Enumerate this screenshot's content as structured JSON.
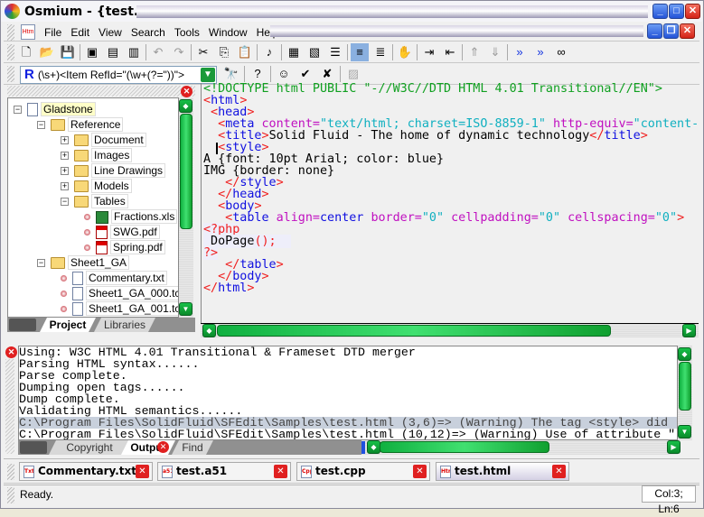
{
  "window": {
    "title": "Osmium - {test.html}",
    "minimize": "_",
    "maximize": "□",
    "close": "✕",
    "app_icon": "osmium-logo-icon"
  },
  "menu": {
    "items": [
      "File",
      "Edit",
      "View",
      "Search",
      "Tools",
      "Window",
      "Help"
    ],
    "doc_icon": "htm-file-icon"
  },
  "toolbar1": {
    "icons": [
      "new-file-icon",
      "open-folder-icon",
      "save-icon",
      "new-project-icon",
      "open-project-icon",
      "save-project-icon",
      "undo-icon",
      "redo-icon",
      "cut-icon",
      "copy-icon",
      "paste-icon",
      "spell-check-icon",
      "word-wrap-icon",
      "char-icon",
      "document-icon",
      "align-left-icon",
      "align-justify-icon",
      "clipboard-select-icon",
      "indent-icon",
      "outdent-icon",
      "move-up-icon",
      "move-down-icon",
      "add-bookmark-icon",
      "remove-bookmark-icon",
      "bookmarks-icon"
    ]
  },
  "toolbar2": {
    "search_value": "(\\s+)<Item RefId=\"(\\w+(?=\"))\">",
    "regex_label": "R",
    "icons": [
      "find-icon",
      "help-doc-icon",
      "smiley-doc-icon",
      "check-doc-icon",
      "cancel-doc-icon",
      "disabled-doc-icon"
    ]
  },
  "project": {
    "tree": [
      {
        "label": "Gladstone",
        "level": 0,
        "type": "project",
        "exp": "-",
        "selected": true
      },
      {
        "label": "Reference",
        "level": 1,
        "type": "folder",
        "exp": "-"
      },
      {
        "label": "Document",
        "level": 2,
        "type": "folder",
        "exp": "+"
      },
      {
        "label": "Images",
        "level": 2,
        "type": "folder",
        "exp": "+"
      },
      {
        "label": "Line Drawings",
        "level": 2,
        "type": "folder",
        "exp": "+"
      },
      {
        "label": "Models",
        "level": 2,
        "type": "folder",
        "exp": "+"
      },
      {
        "label": "Tables",
        "level": 2,
        "type": "folder",
        "exp": "-"
      },
      {
        "label": "Fractions.xls",
        "level": 3,
        "type": "xls"
      },
      {
        "label": "SWG.pdf",
        "level": 3,
        "type": "pdf"
      },
      {
        "label": "Spring.pdf",
        "level": 3,
        "type": "pdf"
      },
      {
        "label": "Sheet1_GA",
        "level": 1,
        "type": "folder",
        "exp": "-"
      },
      {
        "label": "Commentary.txt",
        "level": 2,
        "type": "txt"
      },
      {
        "label": "Sheet1_GA_000.tcw",
        "level": 2,
        "type": "tcw"
      },
      {
        "label": "Sheet1_GA_001.tcw",
        "level": 2,
        "type": "tcw"
      }
    ],
    "tabs": [
      "Project",
      "Libraries"
    ],
    "active_tab": "Project"
  },
  "editor": {
    "lines": [
      [
        [
          "<!DOCTYPE html PUBLIC \"-//W3C//DTD HTML 4.01 Transitional//EN\">",
          "g"
        ]
      ],
      [
        [
          "<",
          "r"
        ],
        [
          "html",
          "b"
        ],
        [
          ">",
          "r"
        ]
      ],
      [
        [
          " <",
          "r"
        ],
        [
          "head",
          "b"
        ],
        [
          ">",
          "r"
        ]
      ],
      [
        [
          "  <",
          "r"
        ],
        [
          "meta ",
          "b"
        ],
        [
          "content=",
          "m"
        ],
        [
          "\"text/html; charset=ISO-8859-1\" ",
          "c"
        ],
        [
          "http-equiv=",
          "m"
        ],
        [
          "\"content-type\">",
          "c"
        ]
      ],
      [
        [
          "  <",
          "r"
        ],
        [
          "title",
          "b"
        ],
        [
          ">",
          "r"
        ],
        [
          "Solid Fluid - The home of dynamic technology",
          "k"
        ],
        [
          "</",
          "r"
        ],
        [
          "title",
          "b"
        ],
        [
          ">",
          "r"
        ]
      ],
      [
        [
          "  <",
          "r"
        ],
        [
          "style",
          "b"
        ],
        [
          ">",
          "r"
        ]
      ],
      [
        [
          "A {font: 10pt Arial; color: blue}",
          "k"
        ]
      ],
      [
        [
          "IMG {border: none}",
          "k"
        ]
      ],
      [
        [
          "   </",
          "r"
        ],
        [
          "style",
          "b"
        ],
        [
          ">",
          "r"
        ]
      ],
      [
        [
          "  </",
          "r"
        ],
        [
          "head",
          "b"
        ],
        [
          ">",
          "r"
        ]
      ],
      [
        [
          "  <",
          "r"
        ],
        [
          "body",
          "b"
        ],
        [
          ">",
          "r"
        ]
      ],
      [
        [
          "   <",
          "r"
        ],
        [
          "table ",
          "b"
        ],
        [
          "align=",
          "m"
        ],
        [
          "center ",
          "b"
        ],
        [
          "border=",
          "m"
        ],
        [
          "\"0\" ",
          "c"
        ],
        [
          "cellpadding=",
          "m"
        ],
        [
          "\"0\" ",
          "c"
        ],
        [
          "cellspacing=",
          "m"
        ],
        [
          "\"0\"",
          "c"
        ],
        [
          ">",
          "r"
        ]
      ],
      [
        [
          "<?php",
          "r",
          "hl"
        ]
      ],
      [
        [
          " DoPage",
          "k",
          "hl"
        ],
        [
          "();",
          "r",
          "hl"
        ],
        [
          "  ",
          "k",
          "hl"
        ]
      ],
      [
        [
          "?>",
          "r",
          "hl"
        ]
      ],
      [
        [
          "   </",
          "r"
        ],
        [
          "table",
          "b"
        ],
        [
          ">",
          "r"
        ]
      ],
      [
        [
          "  </",
          "r"
        ],
        [
          "body",
          "b"
        ],
        [
          ">",
          "r"
        ]
      ],
      [
        [
          "</",
          "r"
        ],
        [
          "html",
          "b"
        ],
        [
          ">",
          "r"
        ]
      ]
    ]
  },
  "output": {
    "lines": [
      "Using: W3C HTML 4.01 Transitional & Frameset DTD merger",
      "Parsing HTML syntax......",
      "Parse complete.",
      "Dumping open tags......",
      "Dump complete.",
      "Validating HTML semantics......",
      "C:\\Program Files\\SolidFluid\\SFEdit\\Samples\\test.html (3,6)=> (Warning) The tag <style> did",
      "C:\\Program Files\\SolidFluid\\SFEdit\\Samples\\test.html (10,12)=> (Warning) Use of attribute \""
    ],
    "selected_line": 6,
    "tabs": [
      "Copyright",
      "Output",
      "Find"
    ],
    "active_tab": "Output"
  },
  "documents": {
    "tabs": [
      {
        "label": "Commentary.txt",
        "icon": "Txt"
      },
      {
        "label": "test.a51",
        "icon": "a51"
      },
      {
        "label": "test.cpp",
        "icon": "Cpp"
      },
      {
        "label": "test.html",
        "icon": "Htm",
        "active": true
      }
    ]
  },
  "status": {
    "text": "Ready.",
    "position": "Col:3; Ln:6"
  },
  "colors": {
    "scrollbar": "#10b040",
    "close": "#e02020",
    "tag": "#f02020",
    "element": "#1010e0",
    "attribute": "#c010c0",
    "value": "#10b0c0",
    "doctype": "#10a020"
  }
}
